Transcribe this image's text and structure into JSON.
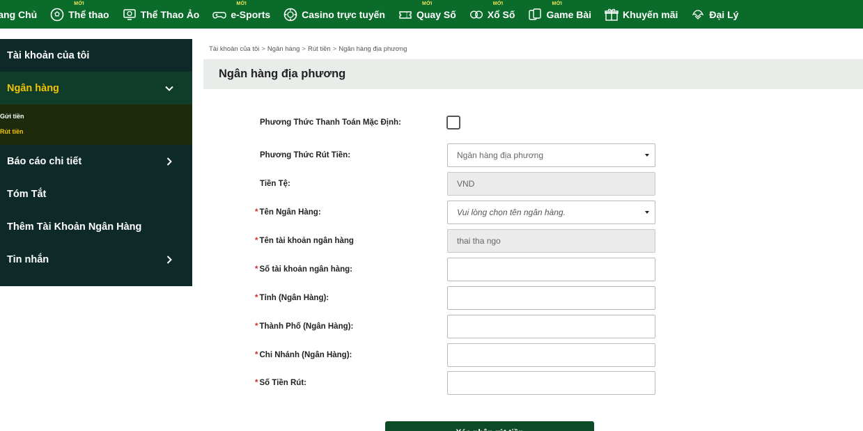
{
  "nav": {
    "items": [
      {
        "label": "Trang Chủ",
        "icon": "home-icon",
        "badge": ""
      },
      {
        "label": "Thể thao",
        "icon": "soccer-ball-icon",
        "badge": "MỚI"
      },
      {
        "label": "Thể Thao Ảo",
        "icon": "virtual-sports-icon",
        "badge": ""
      },
      {
        "label": "e-Sports",
        "icon": "gamepad-icon",
        "badge": "MỚI"
      },
      {
        "label": "Casino trực tuyến",
        "icon": "casino-chip-icon",
        "badge": ""
      },
      {
        "label": "Quay Số",
        "icon": "ticket-icon",
        "badge": "MỚI"
      },
      {
        "label": "Xổ Số",
        "icon": "lottery-balls-icon",
        "badge": "MỚI"
      },
      {
        "label": "Game Bài",
        "icon": "cards-icon",
        "badge": "MỚI"
      },
      {
        "label": "Khuyến mãi",
        "icon": "gift-icon",
        "badge": ""
      },
      {
        "label": "Đại Lý",
        "icon": "agent-icon",
        "badge": ""
      }
    ],
    "badge_text": "MỚI"
  },
  "sidebar": {
    "account": "Tài khoản của tôi",
    "bank": "Ngân hàng",
    "sub_deposit": "Gửi tiền",
    "sub_withdraw": "Rút tiền",
    "report": "Báo cáo chi tiết",
    "summary": "Tóm Tắt",
    "add_bank": "Thêm Tài Khoản Ngân Hàng",
    "messages": "Tin nhắn"
  },
  "breadcrumb": {
    "c1": "Tài khoản của tôi",
    "c2": "Ngân hàng",
    "c3": "Rút tiền",
    "c4": "Ngân hàng địa phương",
    "sep": ">"
  },
  "page": {
    "title": "Ngân hàng địa phương"
  },
  "form": {
    "default_method_label": "Phương Thức Thanh Toán Mặc Định:",
    "withdraw_method_label": "Phương Thức Rút Tiền:",
    "withdraw_method_value": "Ngân hàng địa phương",
    "currency_label": "Tiền Tệ:",
    "currency_value": "VND",
    "bank_name_label": "Tên Ngân Hàng:",
    "bank_name_placeholder": "Vui lòng chọn tên ngân hàng.",
    "account_name_label": "Tên tài khoản ngân hàng",
    "account_name_value": "thai tha ngo",
    "account_number_label": "Số tài khoản ngân hàng:",
    "province_label": "Tỉnh (Ngân Hàng):",
    "city_label": "Thành Phố (Ngân Hàng):",
    "branch_label": "Chi Nhánh (Ngân Hàng):",
    "amount_label": "Số Tiền Rút:",
    "required_mark": "*",
    "submit_label": "Xác nhận rút tiền"
  },
  "colors": {
    "nav_bg": "#0a6b2a",
    "sidebar_bg": "#0e2a28",
    "accent_yellow": "#f2c200",
    "required_red": "#d02a2a",
    "button_bg": "#0d4a26"
  }
}
